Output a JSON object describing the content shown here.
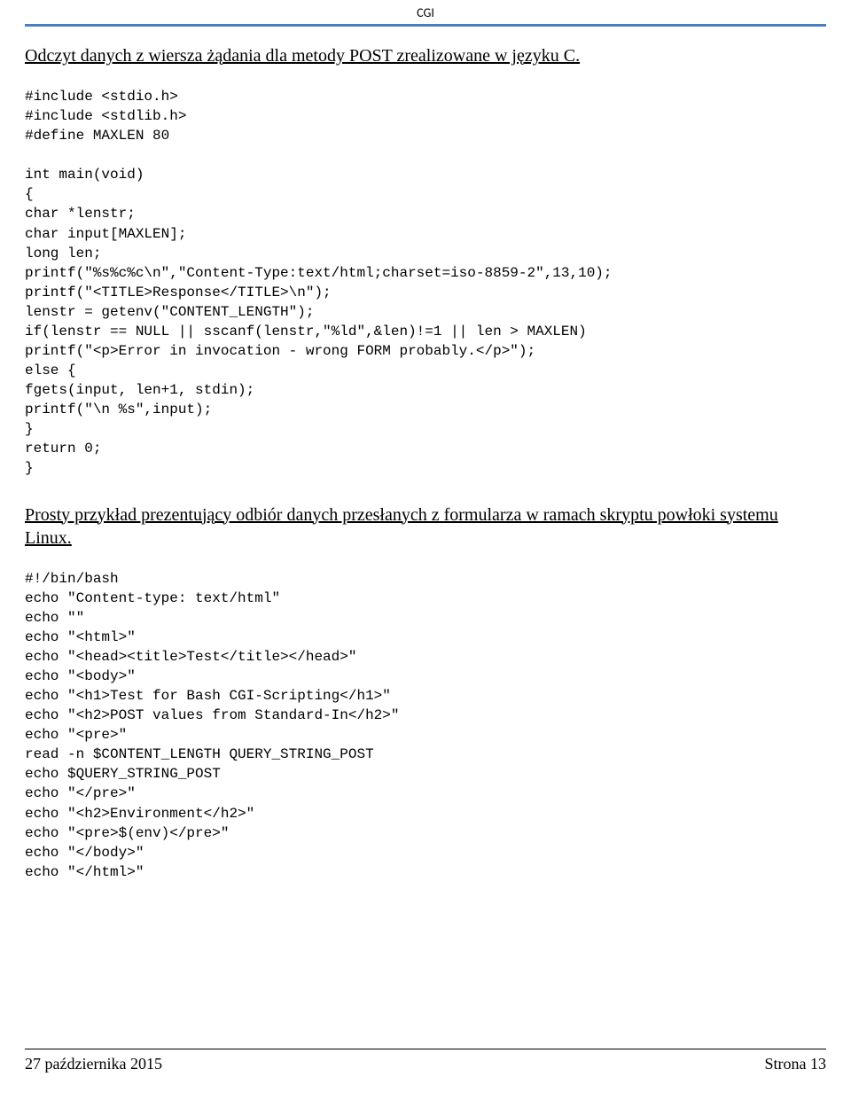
{
  "header": {
    "title": "CGI"
  },
  "section1": {
    "title": "Odczyt danych z wiersza żądania dla metody POST  zrealizowane w języku C."
  },
  "code1": "#include <stdio.h>\n#include <stdlib.h>\n#define MAXLEN 80\n\nint main(void)\n{\nchar *lenstr;\nchar input[MAXLEN];\nlong len;\nprintf(\"%s%c%c\\n\",\"Content-Type:text/html;charset=iso-8859-2\",13,10);\nprintf(\"<TITLE>Response</TITLE>\\n\");\nlenstr = getenv(\"CONTENT_LENGTH\");\nif(lenstr == NULL || sscanf(lenstr,\"%ld\",&len)!=1 || len > MAXLEN)\nprintf(\"<p>Error in invocation - wrong FORM probably.</p>\");\nelse {\nfgets(input, len+1, stdin);\nprintf(\"\\n %s\",input);\n}\nreturn 0;\n}",
  "section2": {
    "title": "Prosty przykład prezentujący odbiór danych przesłanych z formularza w ramach skryptu powłoki systemu Linux."
  },
  "code2": "#!/bin/bash\necho \"Content-type: text/html\"\necho \"\"\necho \"<html>\"\necho \"<head><title>Test</title></head>\"\necho \"<body>\"\necho \"<h1>Test for Bash CGI-Scripting</h1>\"\necho \"<h2>POST values from Standard-In</h2>\"\necho \"<pre>\"\nread -n $CONTENT_LENGTH QUERY_STRING_POST\necho $QUERY_STRING_POST\necho \"</pre>\"\necho \"<h2>Environment</h2>\"\necho \"<pre>$(env)</pre>\"\necho \"</body>\"\necho \"</html>\"",
  "footer": {
    "date": "27 października 2015",
    "page": "Strona 13"
  }
}
